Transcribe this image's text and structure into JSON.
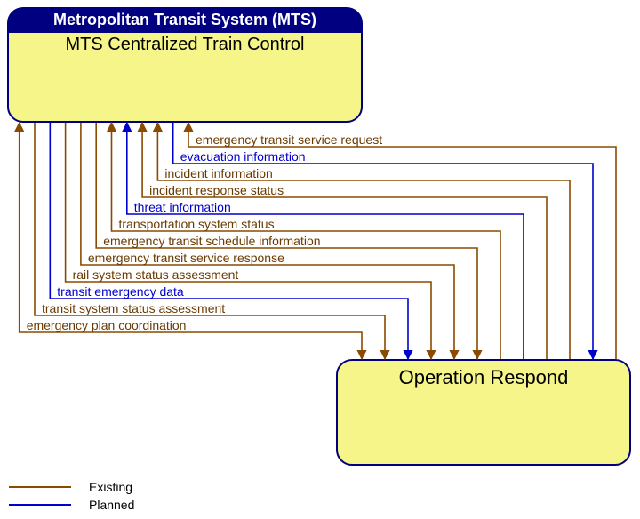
{
  "top_box": {
    "header": "Metropolitan Transit System (MTS)",
    "title": "MTS Centralized Train Control"
  },
  "bottom_box": {
    "title": "Operation Respond"
  },
  "flows": [
    {
      "label": "emergency transit service request",
      "status": "existing",
      "direction": "to_top"
    },
    {
      "label": "evacuation information",
      "status": "planned",
      "direction": "to_bottom"
    },
    {
      "label": "incident information",
      "status": "existing",
      "direction": "to_top"
    },
    {
      "label": "incident response status",
      "status": "existing",
      "direction": "to_top"
    },
    {
      "label": "threat information",
      "status": "planned",
      "direction": "to_top"
    },
    {
      "label": "transportation system status",
      "status": "existing",
      "direction": "to_top"
    },
    {
      "label": "emergency transit schedule information",
      "status": "existing",
      "direction": "to_bottom"
    },
    {
      "label": "emergency transit service response",
      "status": "existing",
      "direction": "to_bottom"
    },
    {
      "label": "rail system status assessment",
      "status": "existing",
      "direction": "to_bottom"
    },
    {
      "label": "transit emergency data",
      "status": "planned",
      "direction": "to_bottom"
    },
    {
      "label": "transit system status assessment",
      "status": "existing",
      "direction": "to_bottom"
    },
    {
      "label": "emergency plan coordination",
      "status": "existing",
      "direction": "both"
    }
  ],
  "legend": {
    "existing": "Existing",
    "planned": "Planned"
  },
  "chart_data": {
    "type": "diagram",
    "nodes": [
      {
        "id": "mts",
        "label": "MTS Centralized Train Control",
        "parent": "Metropolitan Transit System (MTS)"
      },
      {
        "id": "or",
        "label": "Operation Respond"
      }
    ],
    "edges": [
      {
        "from": "or",
        "to": "mts",
        "label": "emergency transit service request",
        "status": "existing"
      },
      {
        "from": "mts",
        "to": "or",
        "label": "evacuation information",
        "status": "planned"
      },
      {
        "from": "or",
        "to": "mts",
        "label": "incident information",
        "status": "existing"
      },
      {
        "from": "or",
        "to": "mts",
        "label": "incident response status",
        "status": "existing"
      },
      {
        "from": "or",
        "to": "mts",
        "label": "threat information",
        "status": "planned"
      },
      {
        "from": "or",
        "to": "mts",
        "label": "transportation system status",
        "status": "existing"
      },
      {
        "from": "mts",
        "to": "or",
        "label": "emergency transit schedule information",
        "status": "existing"
      },
      {
        "from": "mts",
        "to": "or",
        "label": "emergency transit service response",
        "status": "existing"
      },
      {
        "from": "mts",
        "to": "or",
        "label": "rail system status assessment",
        "status": "existing"
      },
      {
        "from": "mts",
        "to": "or",
        "label": "transit emergency data",
        "status": "planned"
      },
      {
        "from": "mts",
        "to": "or",
        "label": "transit system status assessment",
        "status": "existing"
      },
      {
        "from": "mts",
        "to": "or",
        "label": "emergency plan coordination",
        "status": "existing",
        "bidirectional": true
      }
    ]
  }
}
